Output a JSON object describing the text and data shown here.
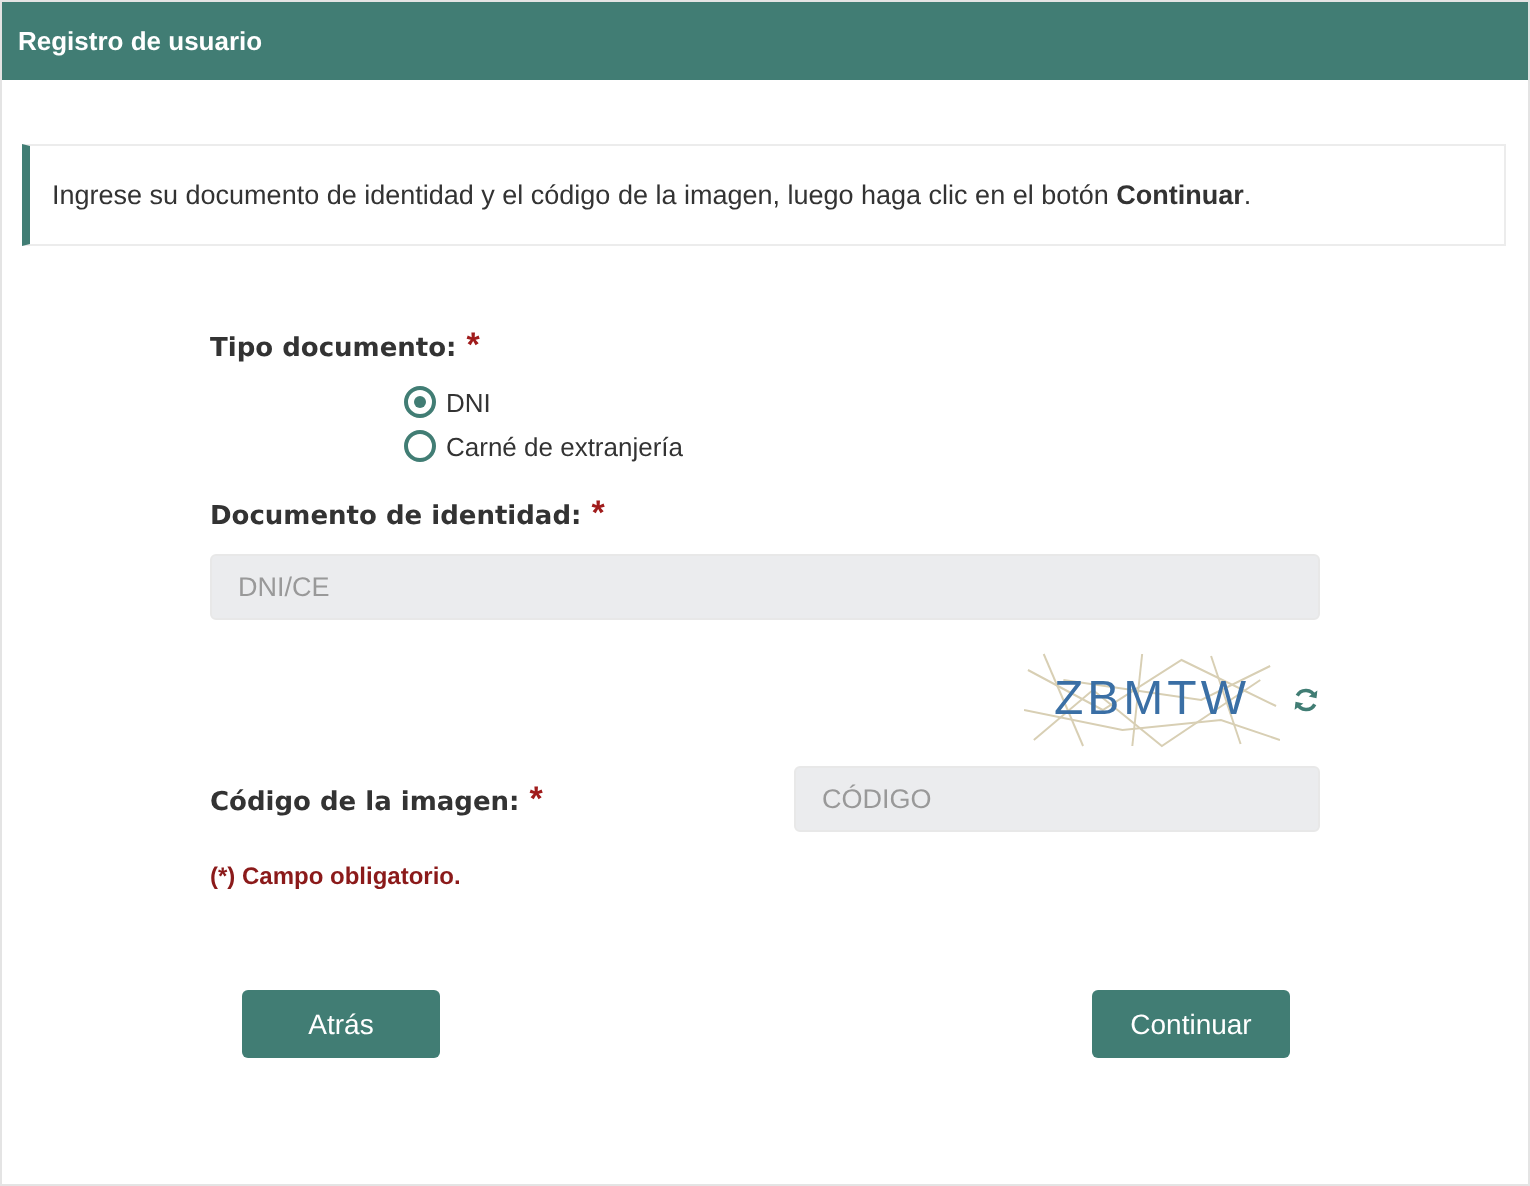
{
  "header": {
    "title": "Registro de usuario"
  },
  "notice": {
    "text": "Ingrese su documento de identidad y el código de la imagen, luego haga clic en el botón **Continuar**."
  },
  "doc_type": {
    "label": "Tipo documento:",
    "required": "*",
    "options": [
      {
        "label": "DNI",
        "selected": true
      },
      {
        "label": "Carné de extranjería",
        "selected": false
      }
    ]
  },
  "doc_number": {
    "label": "Documento de identidad:",
    "required": "*",
    "placeholder": "DNI/CE"
  },
  "captcha": {
    "text": "ZBMTW"
  },
  "code": {
    "label": "Código de la imagen:",
    "required": "*",
    "placeholder": "CÓDIGO"
  },
  "required_note": "(*) Campo obligatorio.",
  "buttons": {
    "back": "Atrás",
    "continue": "Continuar"
  }
}
